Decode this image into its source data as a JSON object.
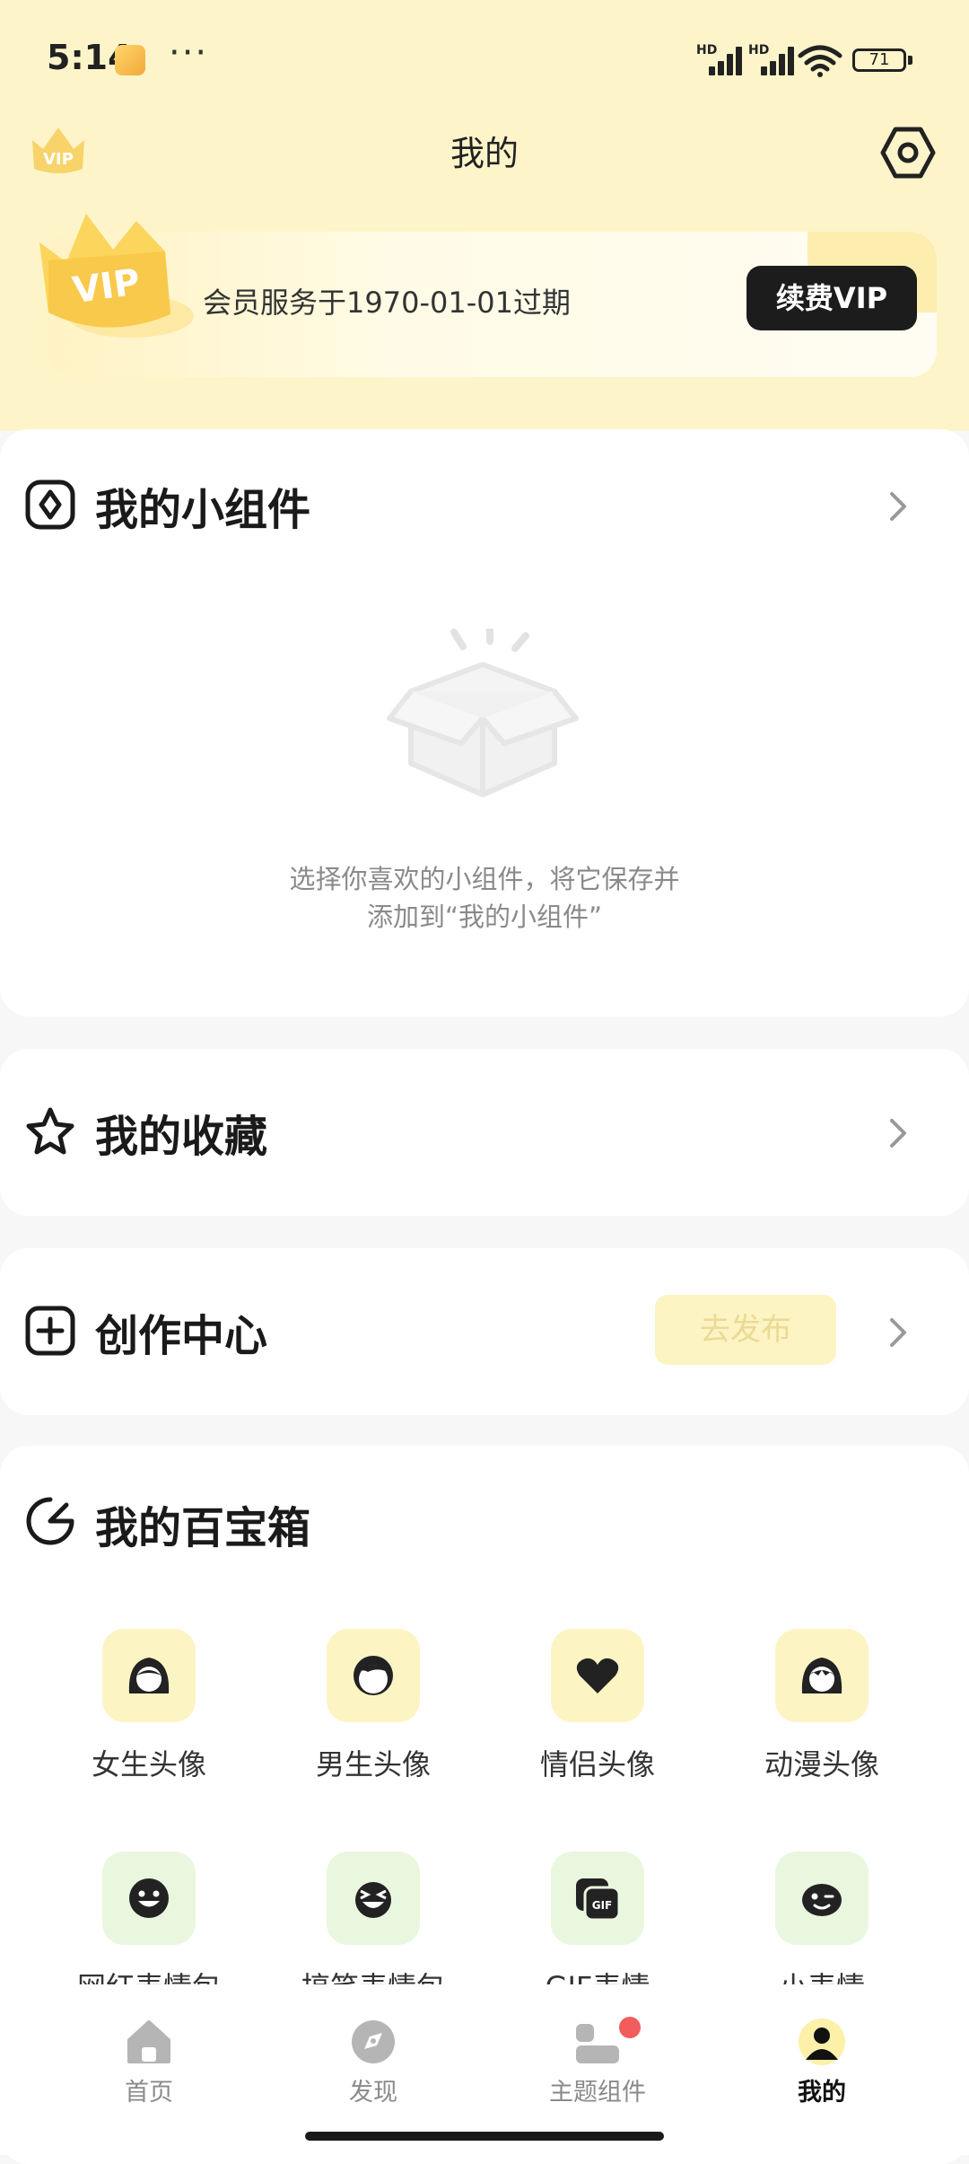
{
  "status_bar": {
    "time": "5:14",
    "more": "···",
    "signal_1_label": "HD",
    "signal_2_label": "HD",
    "battery": "71"
  },
  "header": {
    "title": "我的",
    "vip_badge": "VIP"
  },
  "vip_card": {
    "crown_text": "VIP",
    "expiry_text": "会员服务于1970-01-01过期",
    "renew_label": "续费VIP"
  },
  "widgets_section": {
    "title": "我的小组件",
    "empty_line1": "选择你喜欢的小组件，将它保存并",
    "empty_line2": "添加到“我的小组件”"
  },
  "favorites_section": {
    "title": "我的收藏"
  },
  "creation_section": {
    "title": "创作中心",
    "publish_label": "去发布"
  },
  "toolbox": {
    "title": "我的百宝箱",
    "row1": [
      {
        "label": "女生头像",
        "icon": "girl-avatar-icon"
      },
      {
        "label": "男生头像",
        "icon": "boy-avatar-icon"
      },
      {
        "label": "情侣头像",
        "icon": "heart-icon"
      },
      {
        "label": "动漫头像",
        "icon": "anime-avatar-icon"
      }
    ],
    "row2": [
      {
        "label": "网红表情包",
        "icon": "smile-face-icon"
      },
      {
        "label": "搞笑表情包",
        "icon": "laugh-face-icon"
      },
      {
        "label": "GIF表情",
        "icon": "gif-icon"
      },
      {
        "label": "小表情",
        "icon": "wink-face-icon"
      }
    ]
  },
  "bottom_nav": {
    "items": [
      {
        "label": "首页",
        "icon": "home-icon"
      },
      {
        "label": "发现",
        "icon": "discover-icon"
      },
      {
        "label": "主题组件",
        "icon": "theme-widgets-icon"
      },
      {
        "label": "我的",
        "icon": "profile-icon"
      }
    ],
    "active_index": 3
  },
  "colors": {
    "header_bg": "#fdf5c9",
    "accent_yellow": "#fdf4c4",
    "toolbox_green": "#eaf7df",
    "badge_red": "#f25c5c"
  }
}
